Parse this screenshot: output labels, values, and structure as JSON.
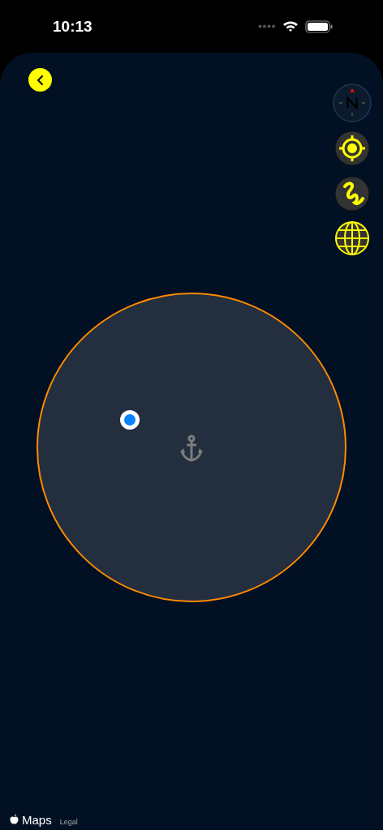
{
  "status_bar": {
    "time": "10:13"
  },
  "map": {
    "attribution": {
      "brand": "Maps",
      "legal": "Legal"
    }
  }
}
